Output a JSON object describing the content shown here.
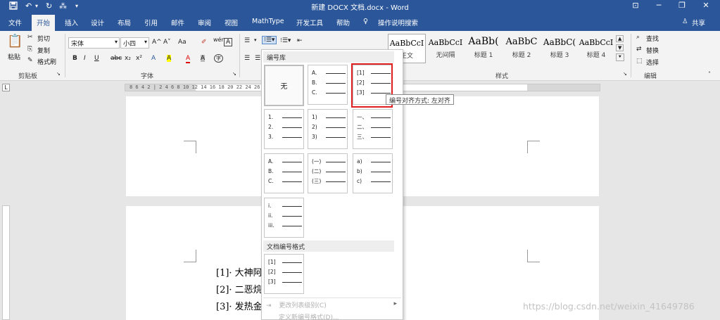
{
  "window": {
    "title": "新建 DOCX 文档.docx - Word",
    "quick_access": [
      "save-icon",
      "undo-icon",
      "redo-icon",
      "touch-mode-icon",
      "customize-icon"
    ],
    "controls": [
      "ribbon-display-icon",
      "minimize-icon",
      "restore-icon",
      "close-icon"
    ]
  },
  "tabs": [
    "文件",
    "开始",
    "插入",
    "设计",
    "布局",
    "引用",
    "邮件",
    "审阅",
    "视图",
    "MathType",
    "开发工具",
    "帮助"
  ],
  "tell_me": "操作说明搜索",
  "share": "共享",
  "clipboard": {
    "paste": "粘贴",
    "cut": "剪切",
    "copy": "复制",
    "format_painter": "格式刷",
    "label": "剪贴板"
  },
  "font": {
    "name": "宋体",
    "size": "小四",
    "row1": [
      "A^",
      "A˅",
      "Aa",
      "wén",
      "A"
    ],
    "row2": [
      "B",
      "I",
      "U",
      "abc",
      "x₂",
      "x²",
      "A",
      "A",
      "A",
      "A",
      "字"
    ],
    "label": "字体"
  },
  "paragraph": {
    "label": "段落"
  },
  "styles": {
    "items": [
      {
        "sample": "AaBbCcI",
        "label": "正文"
      },
      {
        "sample": "AaBbCcI",
        "label": "无间隔"
      },
      {
        "sample": "AaBb(",
        "label": "标题 1"
      },
      {
        "sample": "AaBbC",
        "label": "标题 2"
      },
      {
        "sample": "AaBbC(",
        "label": "标题 3"
      },
      {
        "sample": "AaBbCcI",
        "label": "标题 4"
      }
    ],
    "label": "样式"
  },
  "editing": {
    "find": "查找",
    "replace": "替换",
    "select": "选择",
    "label": "编辑"
  },
  "ruler": {
    "corner": "L",
    "ticks": "8 6 4 2 | 2 4 6 8 10 12 14 16 18 20 22 24 26 28 30 32 34 36 38 40 42"
  },
  "numbering_dropdown": {
    "library_header": "编号库",
    "none_label": "无",
    "library": [
      [
        "A.",
        "B.",
        "C."
      ],
      [
        "[1]",
        "[2]",
        "[3]"
      ],
      [
        "1.",
        "2.",
        "3."
      ],
      [
        "1)",
        "2)",
        "3)"
      ],
      [
        "一、",
        "二、",
        "三、"
      ],
      [
        "A.",
        "B.",
        "C."
      ],
      [
        "(一)",
        "(二)",
        "(三)"
      ],
      [
        "a)",
        "b)",
        "c)"
      ],
      [
        "i.",
        "ii.",
        "iii."
      ]
    ],
    "doc_formats_header": "文档编号格式",
    "doc_formats": [
      [
        "[1]",
        "[2]",
        "[3]"
      ]
    ],
    "change_level": "更改列表级别(C)",
    "define_new": "定义新编号格式(D)..."
  },
  "tooltip": "编号对齐方式: 左对齐",
  "document": {
    "lines": [
      "[1]· 大神阿",
      "[2]· 二恶烷",
      "[3]· 发热金"
    ]
  },
  "watermark": "https://blog.csdn.net/weixin_41649786"
}
